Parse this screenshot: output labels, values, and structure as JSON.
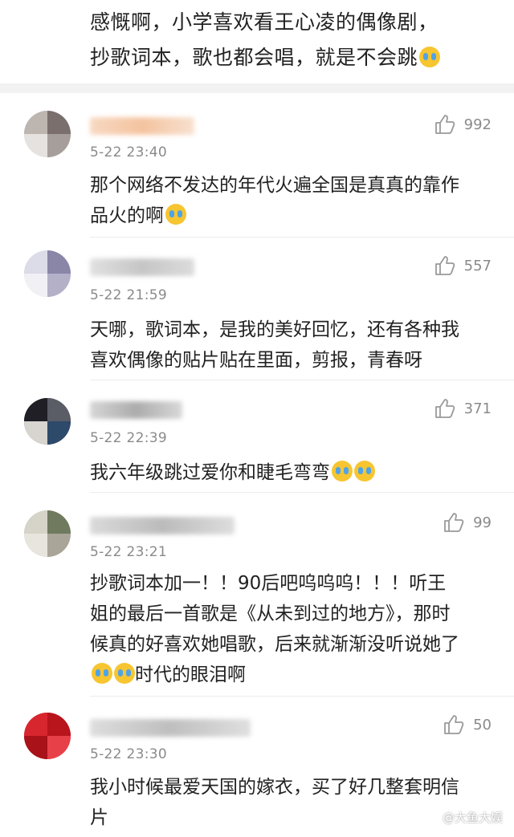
{
  "post": {
    "line1": "感慨啊，小学喜欢看王心凌的偶像剧，",
    "line2": "抄歌词本，歌也都会唱，就是不会跳"
  },
  "comments": [
    {
      "time": "5-22 23:40",
      "likes": "992",
      "line1": "那个网络不发达的年代火遍全国是真真的靠作",
      "line2": "品火的啊"
    },
    {
      "time": "5-22 21:59",
      "likes": "557",
      "line1": "天哪，歌词本，是我的美好回忆，还有各种我",
      "line2": "喜欢偶像的贴片贴在里面，剪报，青春呀"
    },
    {
      "time": "5-22 22:39",
      "likes": "371",
      "line1": "我六年级跳过爱你和睫毛弯弯"
    },
    {
      "time": "5-22 23:21",
      "likes": "99",
      "line1": "抄歌词本加一！！90后吧呜呜呜！！！听王",
      "line2": "姐的最后一首歌是《从未到过的地方》，那时",
      "line3": "候真的好喜欢她唱歌，后来就渐渐没听说她了",
      "line4": "时代的眼泪啊"
    },
    {
      "time": "5-22 23:30",
      "likes": "50",
      "line1": "我小时候最爱天国的嫁衣，买了好几整套明信",
      "line2": "片"
    }
  ],
  "watermark": "@大鱼大娱",
  "icons": {
    "like": "thumbs-up-icon",
    "emoji_laugh": "laughing-tears-emoji",
    "emoji_cry": "crying-emoji"
  }
}
